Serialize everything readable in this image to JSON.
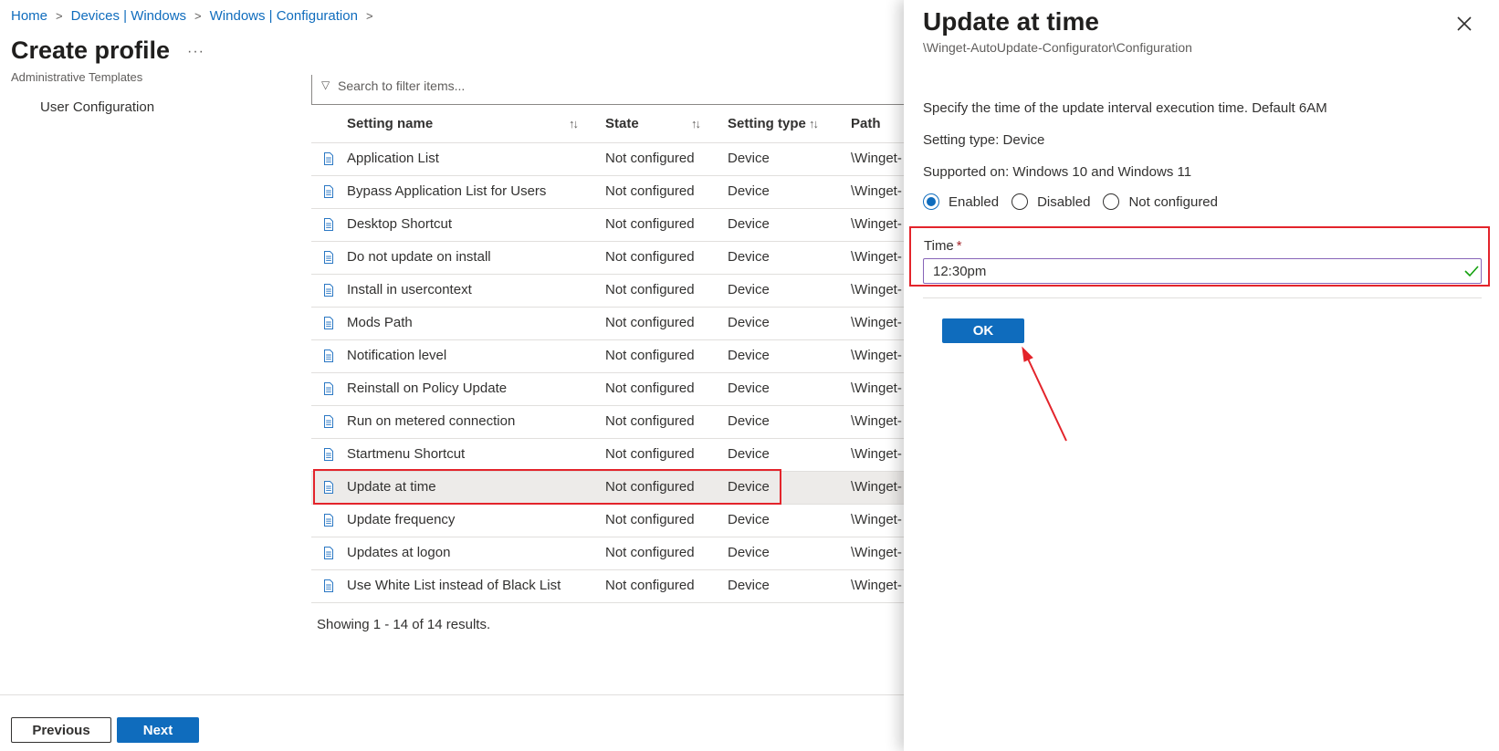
{
  "breadcrumb": [
    {
      "label": "Home"
    },
    {
      "label": "Devices | Windows"
    },
    {
      "label": "Windows | Configuration"
    }
  ],
  "page": {
    "title": "Create profile",
    "more": "···",
    "subtitle": "Administrative Templates",
    "tree_item": "User Configuration"
  },
  "filter": {
    "placeholder": "Search to filter items..."
  },
  "table": {
    "headers": {
      "name": "Setting name",
      "state": "State",
      "type": "Setting type",
      "path": "Path"
    },
    "rows": [
      {
        "name": "Application List",
        "state": "Not configured",
        "type": "Device",
        "path": "\\Winget-"
      },
      {
        "name": "Bypass Application List for Users",
        "state": "Not configured",
        "type": "Device",
        "path": "\\Winget-"
      },
      {
        "name": "Desktop Shortcut",
        "state": "Not configured",
        "type": "Device",
        "path": "\\Winget-"
      },
      {
        "name": "Do not update on install",
        "state": "Not configured",
        "type": "Device",
        "path": "\\Winget-"
      },
      {
        "name": "Install in usercontext",
        "state": "Not configured",
        "type": "Device",
        "path": "\\Winget-"
      },
      {
        "name": "Mods Path",
        "state": "Not configured",
        "type": "Device",
        "path": "\\Winget-"
      },
      {
        "name": "Notification level",
        "state": "Not configured",
        "type": "Device",
        "path": "\\Winget-"
      },
      {
        "name": "Reinstall on Policy Update",
        "state": "Not configured",
        "type": "Device",
        "path": "\\Winget-"
      },
      {
        "name": "Run on metered connection",
        "state": "Not configured",
        "type": "Device",
        "path": "\\Winget-"
      },
      {
        "name": "Startmenu Shortcut",
        "state": "Not configured",
        "type": "Device",
        "path": "\\Winget-"
      },
      {
        "name": "Update at time",
        "state": "Not configured",
        "type": "Device",
        "path": "\\Winget-"
      },
      {
        "name": "Update frequency",
        "state": "Not configured",
        "type": "Device",
        "path": "\\Winget-"
      },
      {
        "name": "Updates at logon",
        "state": "Not configured",
        "type": "Device",
        "path": "\\Winget-"
      },
      {
        "name": "Use White List instead of Black List",
        "state": "Not configured",
        "type": "Device",
        "path": "\\Winget-"
      }
    ],
    "selected_index": 10,
    "results_text": "Showing 1 - 14 of 14 results."
  },
  "footer": {
    "previous": "Previous",
    "next": "Next"
  },
  "panel": {
    "title": "Update at time",
    "path": "\\Winget-AutoUpdate-Configurator\\Configuration",
    "description": "Specify the time of the update interval execution time. Default 6AM",
    "setting_type": "Setting type: Device",
    "supported_on": "Supported on: Windows 10 and Windows 11",
    "options": [
      {
        "label": "Enabled",
        "checked": true
      },
      {
        "label": "Disabled",
        "checked": false
      },
      {
        "label": "Not configured",
        "checked": false
      }
    ],
    "time_label": "Time",
    "required_mark": "*",
    "time_value": "12:30pm",
    "ok": "OK"
  },
  "colors": {
    "accent": "#0f6cbd",
    "highlight": "#e3242b",
    "selected_row": "#edebe9"
  }
}
